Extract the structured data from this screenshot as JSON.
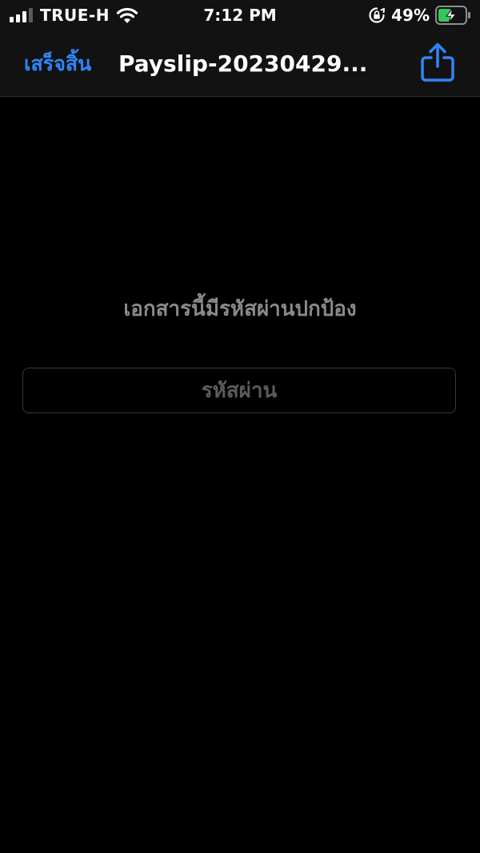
{
  "status_bar": {
    "carrier": "TRUE-H",
    "time": "7:12 PM",
    "battery_percent": "49%",
    "signal_bars_active": 3,
    "signal_bars_total": 4,
    "battery_level": 0.49,
    "charging": true,
    "icons": [
      "cellular-signal-icon",
      "wifi-icon",
      "orientation-lock-icon",
      "battery-charging-icon"
    ]
  },
  "nav_bar": {
    "done_label": "เสร็จสิ้น",
    "title": "Payslip-20230429...",
    "share_icon": "share-icon"
  },
  "content": {
    "prompt": "เอกสารนี้มีรหัสผ่านปกป้อง",
    "password": {
      "value": "",
      "placeholder": "รหัสผ่าน"
    }
  },
  "colors": {
    "accent": "#2f86f6",
    "background": "#000000",
    "bar_background": "#121212",
    "prompt_text": "#8a8a8e",
    "battery_fill": "#34c759"
  }
}
